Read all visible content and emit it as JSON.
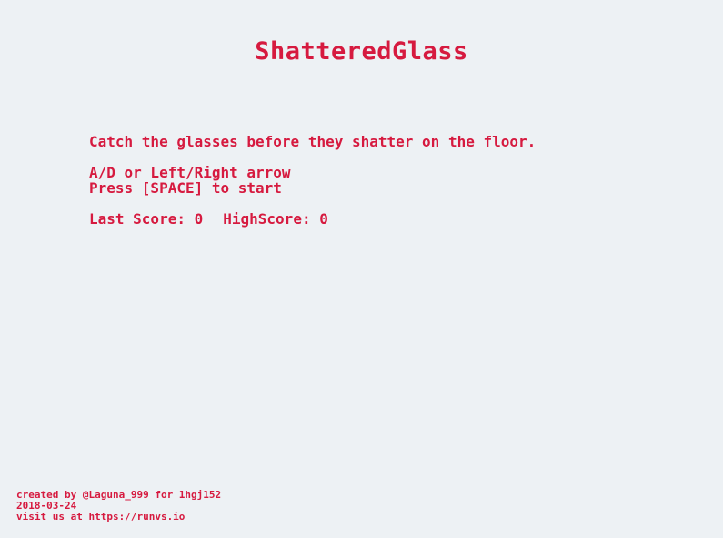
{
  "game": {
    "title": "ShatteredGlass",
    "instructions": {
      "line1": "Catch the glasses before they shatter on the floor.",
      "line2": "A/D or Left/Right arrow",
      "line3": "Press [SPACE] to start"
    },
    "scores": {
      "last_label": "Last Score:",
      "last_value": "0",
      "high_label": "HighScore:",
      "high_value": "0"
    },
    "footer": {
      "credit": "created by @Laguna_999 for 1hgj152",
      "date": "2018-03-24",
      "visit": "visit us at https://runvs.io"
    },
    "colors": {
      "background": "#edf1f4",
      "text": "#d61a3f"
    }
  }
}
